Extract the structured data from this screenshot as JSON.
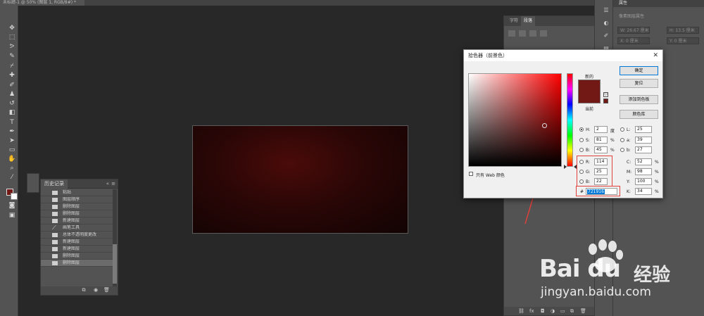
{
  "document": {
    "tab_label": "未标题-1 @ 50% (图层 1, RGB/8#) *"
  },
  "toolbar": {
    "tools": [
      "move-tool",
      "marquee-tool",
      "lasso-tool",
      "magic-wand-tool",
      "eyedropper-tool",
      "healing-brush-tool",
      "brush-tool",
      "clone-stamp-tool",
      "history-brush-tool",
      "eraser-tool",
      "gradient-tool",
      "blur-tool",
      "dodge-tool",
      "pen-tool",
      "type-tool",
      "path-selection-tool",
      "rectangle-tool",
      "hand-tool",
      "zoom-tool"
    ],
    "foreground_color": "#721916",
    "background_color": "#ffffff"
  },
  "history": {
    "tab": "历史记录",
    "collapse": "«",
    "items": [
      {
        "label": "粘贴",
        "selected": false
      },
      {
        "label": "图层顺序",
        "selected": false
      },
      {
        "label": "删除图层",
        "selected": false
      },
      {
        "label": "删除图层",
        "selected": false
      },
      {
        "label": "新建图层",
        "selected": false
      },
      {
        "label": "画笔工具",
        "selected": false
      },
      {
        "label": "总体不透明度更改",
        "selected": false
      },
      {
        "label": "新建图层",
        "selected": false
      },
      {
        "label": "新建图层",
        "selected": false
      },
      {
        "label": "删除图层",
        "selected": false
      },
      {
        "label": "删除图层",
        "selected": true
      }
    ]
  },
  "paragraph_panel": {
    "tabs": [
      "字符",
      "段落"
    ]
  },
  "properties_panel": {
    "title": "属性",
    "subtitle": "像素图层属性",
    "w_label": "W: 26.67 厘米",
    "h_label": "H: 13.5 厘米",
    "x_label": "X: 0 厘米",
    "y_label": "Y: 0 厘米"
  },
  "color_picker": {
    "title": "拾色器（前景色）",
    "close": "✕",
    "new_label": "新的",
    "current_label": "当前",
    "buttons": {
      "ok": "确定",
      "reset": "复位",
      "add_swatch": "添加到色板",
      "libraries": "颜色库"
    },
    "web_only_label": "只有 Web 颜色",
    "hsb": {
      "H": "2",
      "S": "81",
      "B": "45",
      "h_unit": "度",
      "s_unit": "%",
      "b_unit": "%"
    },
    "rgb": {
      "R": "114",
      "G": "25",
      "B": "22"
    },
    "lab": {
      "L": "25",
      "a": "39",
      "b": "27"
    },
    "cmyk": {
      "C": "52",
      "M": "98",
      "Y": "100",
      "K": "34",
      "unit": "%"
    },
    "hex": "721916",
    "hex_label": "#",
    "selected_color": "#721916"
  },
  "watermark": {
    "brand": "Bai du",
    "suffix": "经验",
    "url": "jingyan.baidu.com"
  },
  "colors": {
    "accent": "#0078d7",
    "annotation": "#e0403a",
    "panel_bg": "#535353",
    "workspace_bg": "#282828"
  }
}
